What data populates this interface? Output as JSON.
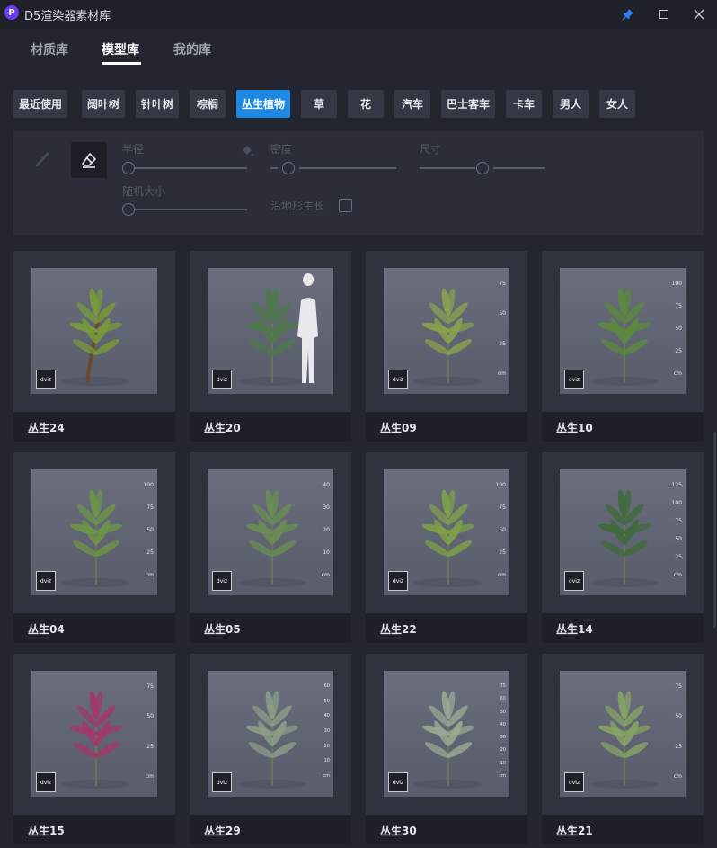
{
  "window": {
    "logo_letter": "P",
    "title": "D5渲染器素材库",
    "pin_icon": "pin-icon",
    "maximize_icon": "maximize-icon",
    "close_icon": "close-icon"
  },
  "main_tabs": [
    {
      "label": "材质库",
      "active": false
    },
    {
      "label": "模型库",
      "active": true
    },
    {
      "label": "我的库",
      "active": false
    }
  ],
  "categories": [
    {
      "label": "最近使用",
      "active": false
    },
    {
      "label": "阔叶树",
      "active": false
    },
    {
      "label": "针叶树",
      "active": false
    },
    {
      "label": "棕榈",
      "active": false
    },
    {
      "label": "丛生植物",
      "active": true
    },
    {
      "label": "草",
      "active": false
    },
    {
      "label": "花",
      "active": false
    },
    {
      "label": "汽车",
      "active": false
    },
    {
      "label": "巴士客车",
      "active": false
    },
    {
      "label": "卡车",
      "active": false
    },
    {
      "label": "男人",
      "active": false
    },
    {
      "label": "女人",
      "active": false
    }
  ],
  "brush_panel": {
    "radius_label": "半径",
    "density_label": "密度",
    "size_label": "尺寸",
    "random_size_label": "随机大小",
    "terrain_growth_label": "沿地形生长",
    "terrain_growth_checked": false,
    "brush_icon": "brush-icon",
    "eraser_icon": "eraser-icon",
    "fill_icon": "paint-bucket-icon"
  },
  "badge_text": "dviz",
  "colors": {
    "accent": "#1e88e5",
    "background": "#23262f",
    "card": "#2f333e",
    "logo": "#6a3df0"
  },
  "models": [
    {
      "name": "丛生24",
      "ruler": []
    },
    {
      "name": "丛生20",
      "ruler": []
    },
    {
      "name": "丛生09",
      "ruler": [
        "75",
        "50",
        "25",
        "cm"
      ]
    },
    {
      "name": "丛生10",
      "ruler": [
        "100",
        "75",
        "50",
        "25",
        "cm"
      ]
    },
    {
      "name": "丛生04",
      "ruler": [
        "100",
        "75",
        "50",
        "25",
        "cm"
      ]
    },
    {
      "name": "丛生05",
      "ruler": [
        "40",
        "30",
        "20",
        "10",
        "cm"
      ]
    },
    {
      "name": "丛生22",
      "ruler": [
        "100",
        "75",
        "50",
        "25",
        "cm"
      ]
    },
    {
      "name": "丛生14",
      "ruler": [
        "125",
        "100",
        "75",
        "50",
        "25",
        "cm"
      ]
    },
    {
      "name": "丛生15",
      "ruler": [
        "75",
        "50",
        "25",
        "cm"
      ]
    },
    {
      "name": "丛生29",
      "ruler": [
        "60",
        "50",
        "40",
        "30",
        "20",
        "10",
        "cm"
      ]
    },
    {
      "name": "丛生30",
      "ruler": [
        "75",
        "60",
        "50",
        "40",
        "30",
        "20",
        "10",
        "cm"
      ]
    },
    {
      "name": "丛生21",
      "ruler": [
        "75",
        "50",
        "25",
        "cm"
      ]
    }
  ]
}
